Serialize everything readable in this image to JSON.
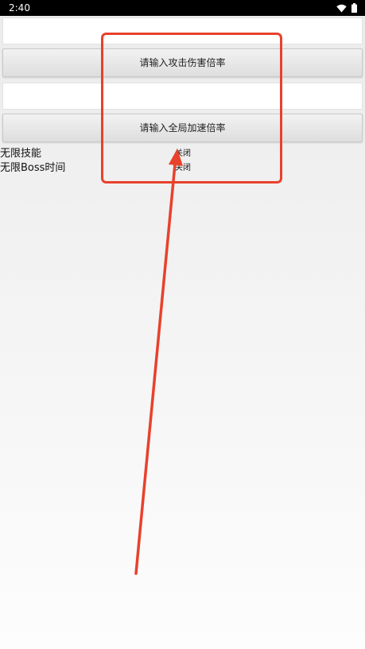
{
  "status_bar": {
    "time": "2:40",
    "icons": [
      "wifi-icon",
      "battery-icon"
    ]
  },
  "form": {
    "attack_input": {
      "value": "",
      "placeholder": ""
    },
    "attack_button_label": "请输入攻击伤害倍率",
    "speed_input": {
      "value": "",
      "placeholder": ""
    },
    "speed_button_label": "请输入全局加速倍率"
  },
  "toggles": [
    {
      "label": "无限技能",
      "state": "关闭"
    },
    {
      "label": "无限Boss时间",
      "state": "关闭"
    }
  ],
  "annotation": {
    "color": "#e8412c"
  }
}
